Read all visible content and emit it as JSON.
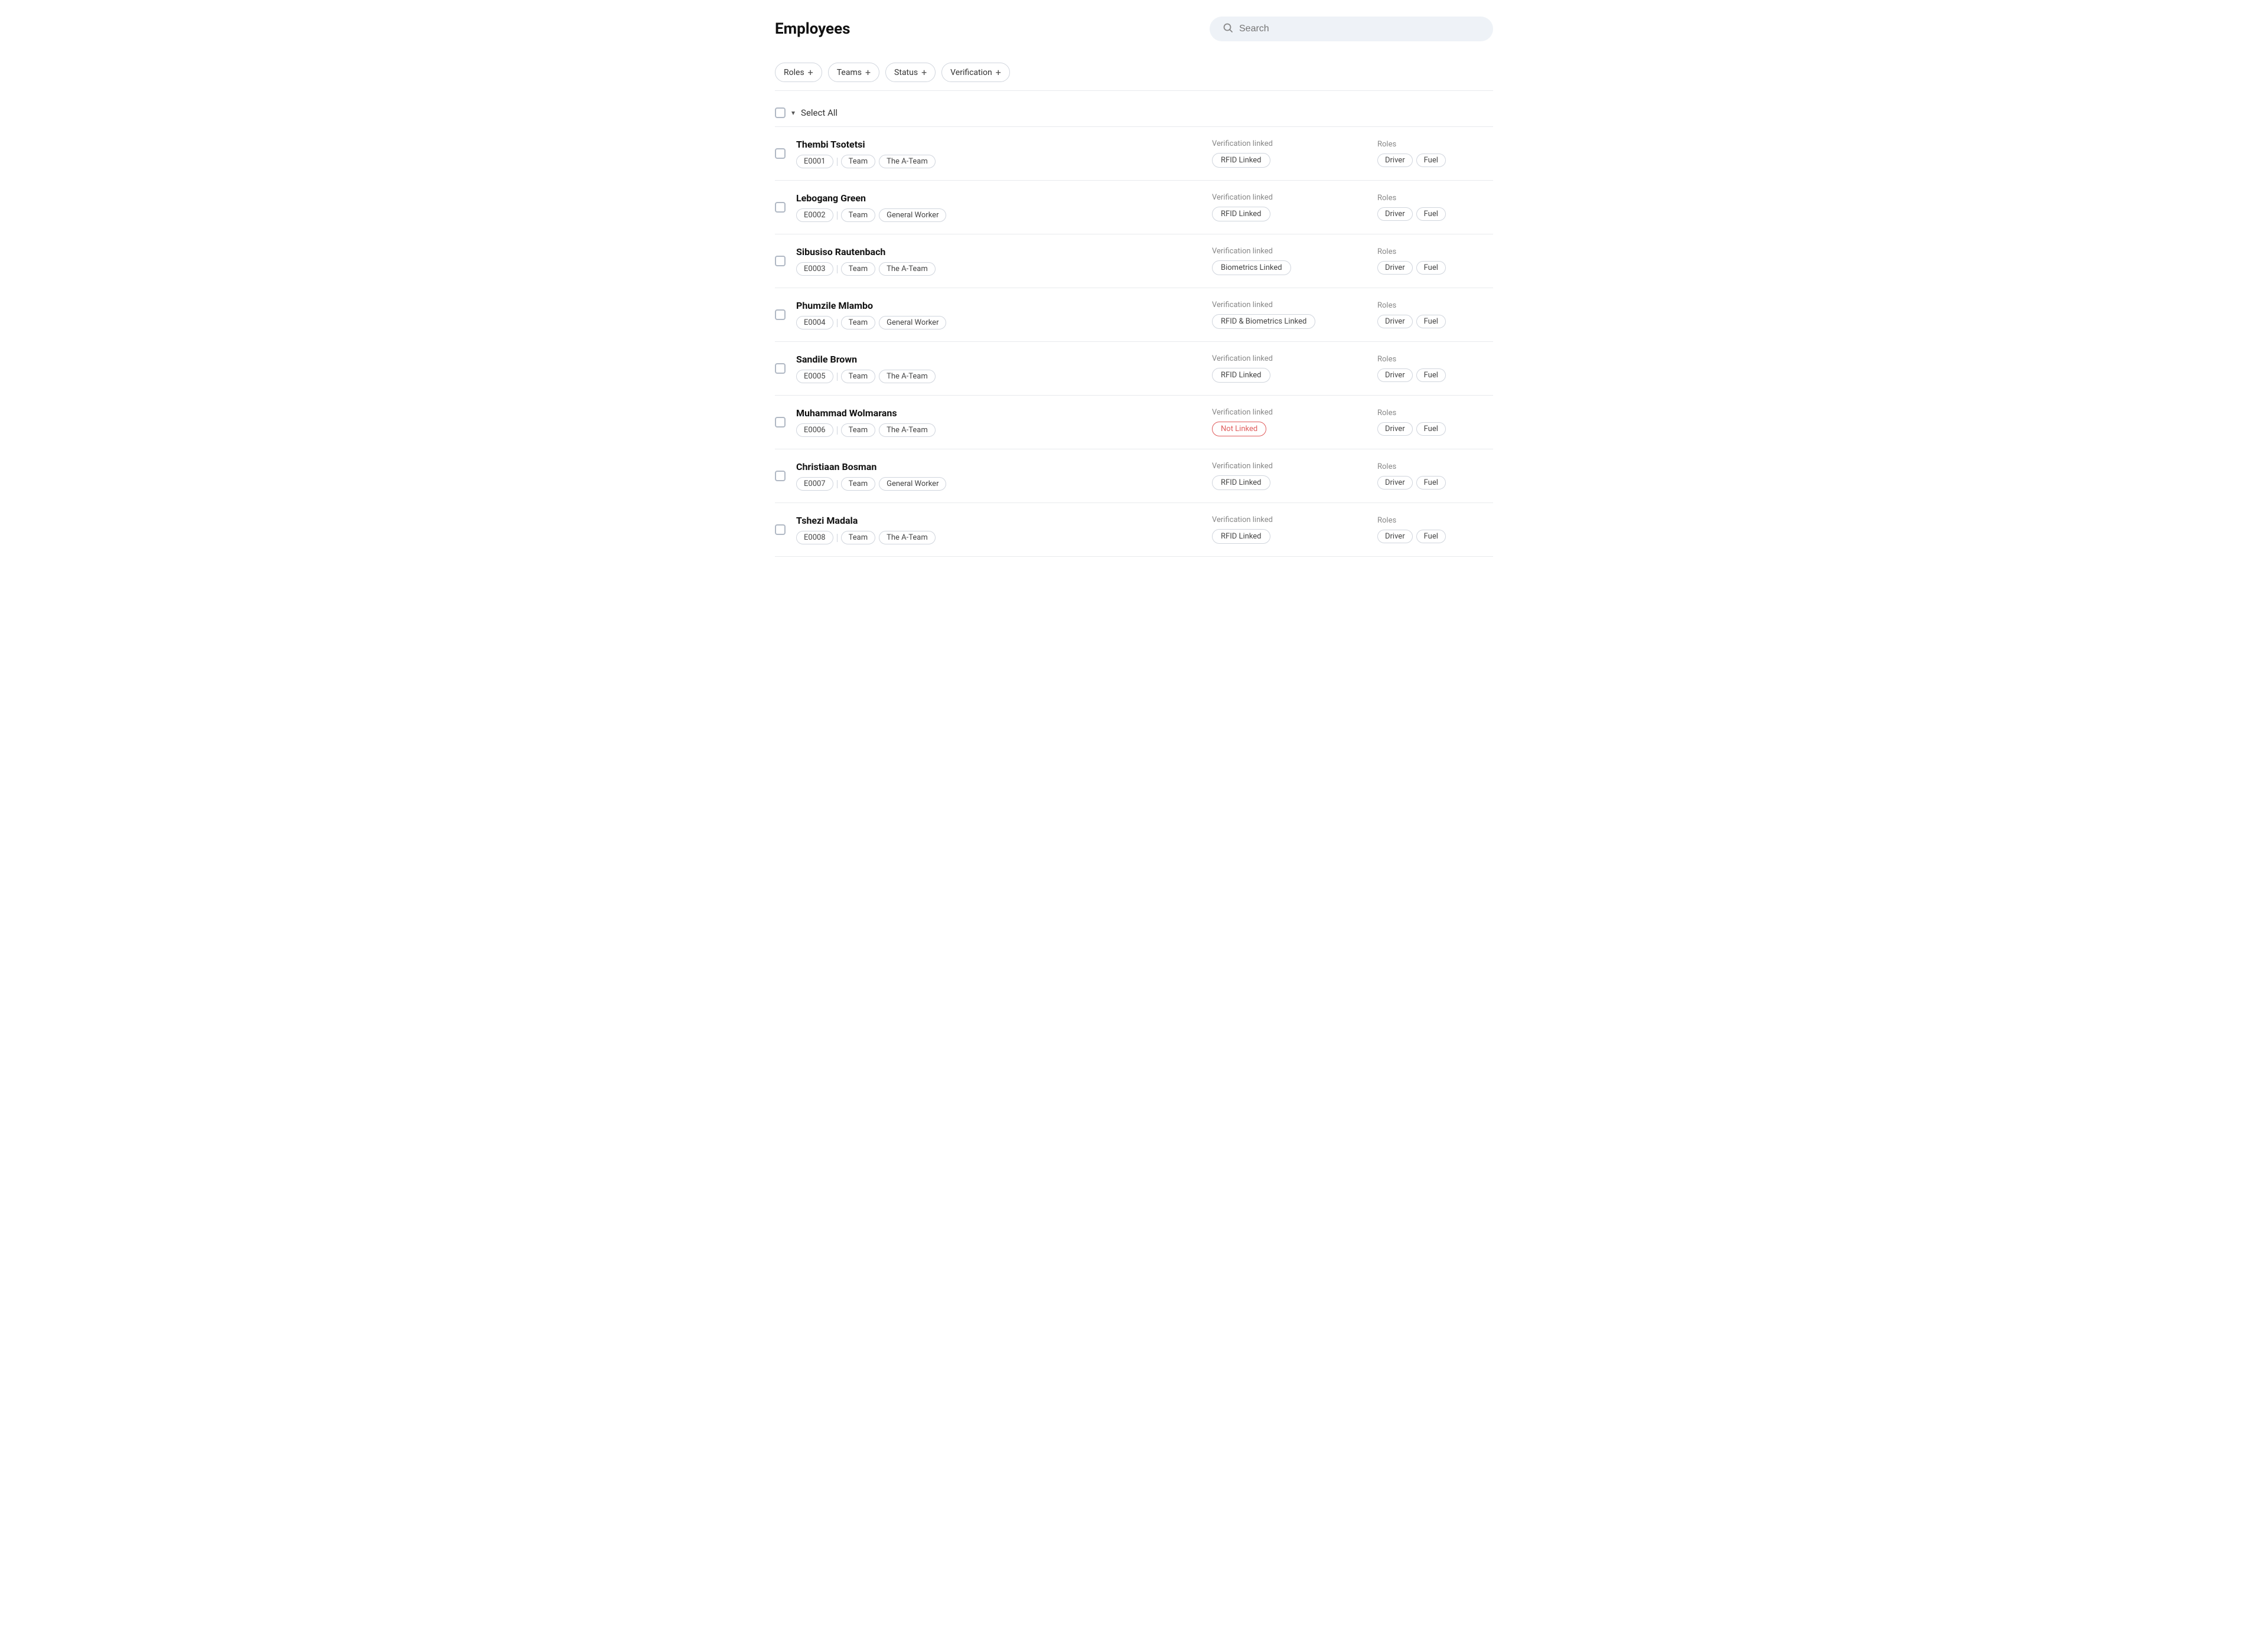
{
  "header": {
    "title": "Employees",
    "search_placeholder": "Search"
  },
  "filters": [
    {
      "label": "Roles",
      "icon": "+"
    },
    {
      "label": "Teams",
      "icon": "+"
    },
    {
      "label": "Status",
      "icon": "+"
    },
    {
      "label": "Verification",
      "icon": "+"
    }
  ],
  "select_all_label": "Select All",
  "employees": [
    {
      "name": "Thembi Tsotetsi",
      "id": "E0001",
      "team_label": "Team",
      "team": "The A-Team",
      "verification_label": "Verification linked",
      "verification": "RFID Linked",
      "not_linked": false,
      "roles_label": "Roles",
      "roles": [
        "Driver",
        "Fuel"
      ]
    },
    {
      "name": "Lebogang Green",
      "id": "E0002",
      "team_label": "Team",
      "team": "General Worker",
      "verification_label": "Verification linked",
      "verification": "RFID Linked",
      "not_linked": false,
      "roles_label": "Roles",
      "roles": [
        "Driver",
        "Fuel"
      ]
    },
    {
      "name": "Sibusiso Rautenbach",
      "id": "E0003",
      "team_label": "Team",
      "team": "The A-Team",
      "verification_label": "Verification linked",
      "verification": "Biometrics Linked",
      "not_linked": false,
      "roles_label": "Roles",
      "roles": [
        "Driver",
        "Fuel"
      ]
    },
    {
      "name": "Phumzile Mlambo",
      "id": "E0004",
      "team_label": "Team",
      "team": "General Worker",
      "verification_label": "Verification linked",
      "verification": "RFID & Biometrics Linked",
      "not_linked": false,
      "roles_label": "Roles",
      "roles": [
        "Driver",
        "Fuel"
      ]
    },
    {
      "name": "Sandile Brown",
      "id": "E0005",
      "team_label": "Team",
      "team": "The A-Team",
      "verification_label": "Verification linked",
      "verification": "RFID Linked",
      "not_linked": false,
      "roles_label": "Roles",
      "roles": [
        "Driver",
        "Fuel"
      ]
    },
    {
      "name": "Muhammad Wolmarans",
      "id": "E0006",
      "team_label": "Team",
      "team": "The A-Team",
      "verification_label": "Verification linked",
      "verification": "Not Linked",
      "not_linked": true,
      "roles_label": "Roles",
      "roles": [
        "Driver",
        "Fuel"
      ]
    },
    {
      "name": "Christiaan Bosman",
      "id": "E0007",
      "team_label": "Team",
      "team": "General Worker",
      "verification_label": "Verification linked",
      "verification": "RFID Linked",
      "not_linked": false,
      "roles_label": "Roles",
      "roles": [
        "Driver",
        "Fuel"
      ]
    },
    {
      "name": "Tshezi Madala",
      "id": "E0008",
      "team_label": "Team",
      "team": "The A-Team",
      "verification_label": "Verification linked",
      "verification": "RFID Linked",
      "not_linked": false,
      "roles_label": "Roles",
      "roles": [
        "Driver",
        "Fuel"
      ]
    }
  ]
}
